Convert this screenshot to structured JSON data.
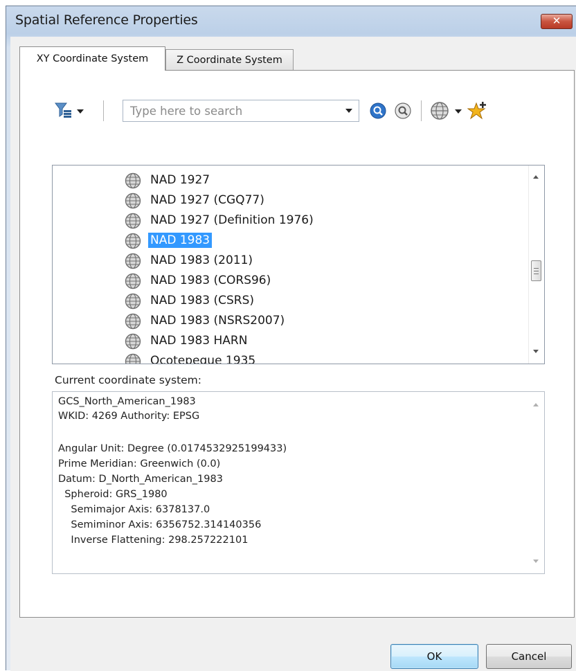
{
  "window": {
    "title": "Spatial Reference Properties",
    "close_label": "✕"
  },
  "tabs": [
    {
      "label": "XY Coordinate System",
      "active": true
    },
    {
      "label": "Z Coordinate System",
      "active": false
    }
  ],
  "toolbar": {
    "filter_icon": "filter-icon",
    "search_placeholder": "Type here to search",
    "search_icon": "search-icon",
    "clear_search_icon": "clear-search-icon",
    "globe_add_icon": "globe-add-icon",
    "favorite_icon": "add-favorite-icon"
  },
  "coordinate_list": {
    "items": [
      {
        "label": "NAD 1927",
        "selected": false
      },
      {
        "label": "NAD 1927 (CGQ77)",
        "selected": false
      },
      {
        "label": "NAD 1927 (Definition 1976)",
        "selected": false
      },
      {
        "label": "NAD 1983",
        "selected": true
      },
      {
        "label": "NAD 1983 (2011)",
        "selected": false
      },
      {
        "label": "NAD 1983 (CORS96)",
        "selected": false
      },
      {
        "label": "NAD 1983 (CSRS)",
        "selected": false
      },
      {
        "label": "NAD 1983 (NSRS2007)",
        "selected": false
      },
      {
        "label": "NAD 1983 HARN",
        "selected": false
      },
      {
        "label": "Ocotepeque 1935",
        "selected": false
      }
    ]
  },
  "current": {
    "label": "Current coordinate system:",
    "lines": [
      "GCS_North_American_1983",
      "WKID: 4269 Authority: EPSG",
      "",
      "Angular Unit: Degree (0.0174532925199433)",
      "Prime Meridian: Greenwich (0.0)",
      "Datum: D_North_American_1983",
      "  Spheroid: GRS_1980",
      "    Semimajor Axis: 6378137.0",
      "    Semiminor Axis: 6356752.314140356",
      "    Inverse Flattening: 298.257222101"
    ]
  },
  "buttons": {
    "ok": "OK",
    "cancel": "Cancel"
  },
  "colors": {
    "selection": "#3399ff",
    "close_button": "#c9543f"
  }
}
